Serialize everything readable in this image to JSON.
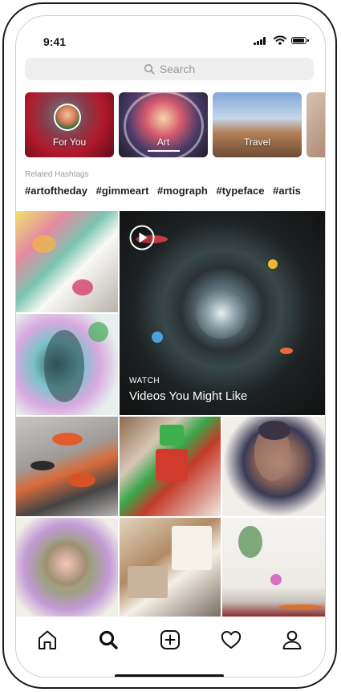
{
  "status": {
    "time": "9:41"
  },
  "search": {
    "placeholder": "Search"
  },
  "categories": [
    {
      "label": "For You"
    },
    {
      "label": "Art"
    },
    {
      "label": "Travel"
    }
  ],
  "hashtags": {
    "heading": "Related Hashtags",
    "items": [
      "#artoftheday",
      "#gimmeart",
      "#mograph",
      "#typeface",
      "#artis"
    ]
  },
  "video_tile": {
    "kicker": "WATCH",
    "title": "Videos You Might Like"
  },
  "tabbar": {
    "items": [
      "home-icon",
      "search-icon",
      "add-post-icon",
      "heart-icon",
      "profile-icon"
    ],
    "active": "search-icon"
  },
  "colors": {
    "accent": "#111111",
    "placeholder": "#9a9a9a",
    "search_bg": "#efefef"
  }
}
